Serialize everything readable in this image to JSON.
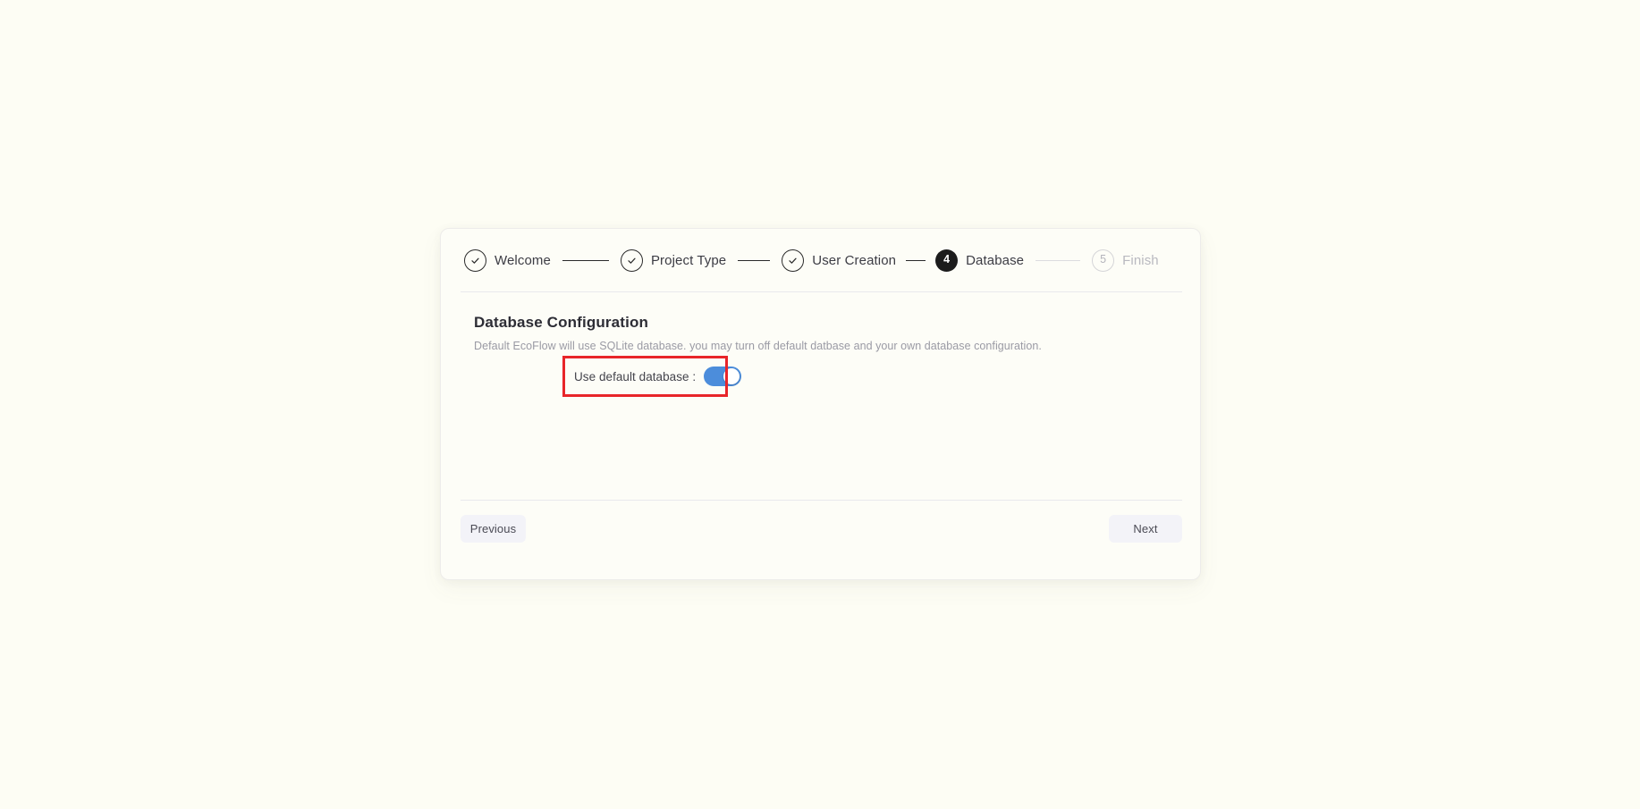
{
  "page": {
    "background_color": "#fdfdf4",
    "card_background_color": "#fdfdf7"
  },
  "stepper": {
    "steps": [
      {
        "label": "Welcome",
        "marker": "check",
        "state": "done"
      },
      {
        "label": "Project Type",
        "marker": "check",
        "state": "done"
      },
      {
        "label": "User Creation",
        "marker": "check",
        "state": "done"
      },
      {
        "label": "Database",
        "marker": "4",
        "state": "current"
      },
      {
        "label": "Finish",
        "marker": "5",
        "state": "pending"
      }
    ],
    "current_step_number": "4",
    "current_step_label": "Database",
    "total_steps": "5",
    "active_color": "#1c1c1c",
    "pending_color": "#b9b9c0"
  },
  "section": {
    "heading": "Database Configuration",
    "subtitle": "Default EcoFlow will use SQLite database. you may turn off default datbase and your own database configuration."
  },
  "settings": {
    "default_database": {
      "label": "Use default database :",
      "value": "on",
      "toggle_color": "#4c8ddb",
      "highlighted": "true",
      "highlight_color": "#e8252a"
    }
  },
  "footer": {
    "previous_label": "Previous",
    "next_label": "Next",
    "button_background": "#f3f3f8"
  }
}
